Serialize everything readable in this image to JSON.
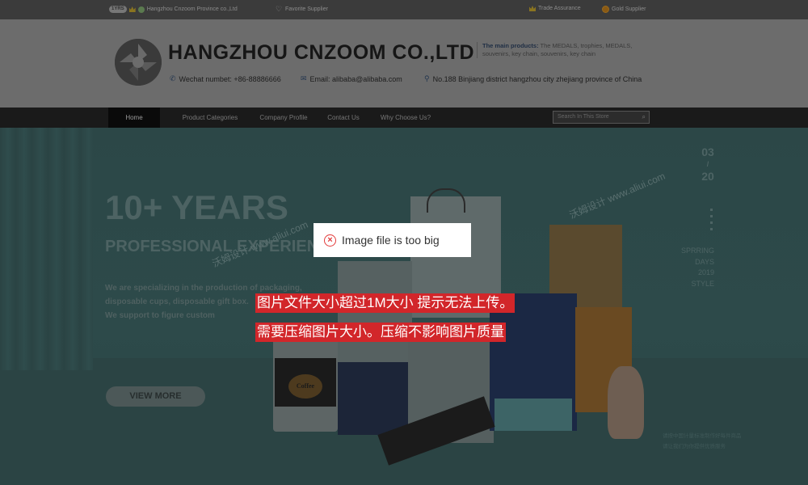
{
  "topbar": {
    "years_badge": "1YRS",
    "company_small": "Hangzhou Cnzoom Province co.,Ltd",
    "favorite": "Favorite Supplier",
    "trade_assurance": "Trade Assurance",
    "gold_supplier": "Gold Supplier"
  },
  "header": {
    "company_name": "HANGZHOU CNZOOM CO.,LTD",
    "products_label": "The main products:",
    "products_text": "The MEDALS, trophies, MEDALS, souvenirs, key chain, souvenirs, key chain",
    "wechat": "Wechat numbet: +86-88886666",
    "email": "Email: alibaba@alibaba.com",
    "address": "No.188 Binjiang district hangzhou city zhejiang province of China"
  },
  "nav": {
    "items": [
      "Home",
      "Product Categories",
      "Company Profile",
      "Contact Us",
      "Why Choose Us?"
    ],
    "search_placeholder": "Search In This Store"
  },
  "banner": {
    "years": "10+ YEARS",
    "professional": "PROFESSIONAL EXPERIENCE",
    "intro_lines": [
      "We are specializing in the production of packaging,",
      "disposable cups, disposable gift box.",
      "We support to figure custom"
    ],
    "view_more": "VIEW MORE",
    "date_day": "03",
    "date_slash": "/",
    "date_num": "20",
    "style_lines": [
      "SPRRING",
      "DAYS",
      "2019",
      "STYLE"
    ],
    "watermark": "沃姆设计 www.aliui.com",
    "small_cn_lines": [
      "请按中国计量标准制作好每件商品",
      "请让我们为你提供优质服务"
    ]
  },
  "overlay": {
    "error_text": "Image file is too big",
    "note_line1": "图片文件大小超过1M大小 提示无法上传。",
    "note_line2": "需要压缩图片大小。压缩不影响图片质量"
  },
  "colors": {
    "error_red": "#e33a3a",
    "note_bg": "#d2262a",
    "banner_teal": "#2d4a4a"
  }
}
